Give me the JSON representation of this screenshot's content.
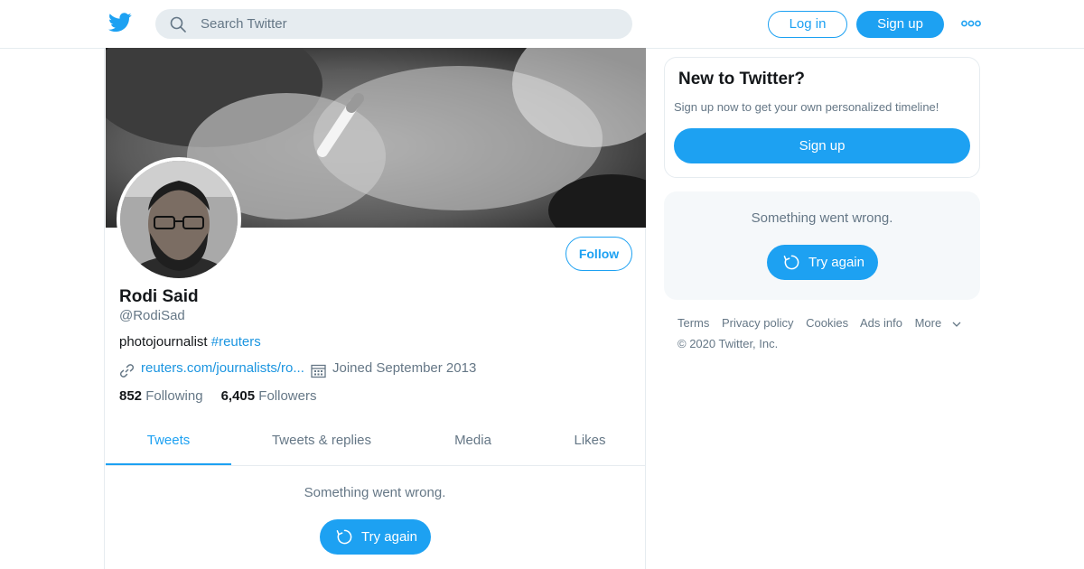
{
  "header": {
    "search_placeholder": "Search Twitter",
    "login_label": "Log in",
    "signup_label": "Sign up"
  },
  "profile": {
    "name": "Rodi Said",
    "handle": "@RodiSad",
    "bio_text": "photojournalist ",
    "bio_hashtag": "#reuters",
    "website": "reuters.com/journalists/ro...",
    "joined": "Joined September 2013",
    "following_count": "852",
    "following_label": "Following",
    "followers_count": "6,405",
    "followers_label": "Followers",
    "follow_label": "Follow"
  },
  "tabs": [
    {
      "label": "Tweets",
      "active": true
    },
    {
      "label": "Tweets & replies",
      "active": false
    },
    {
      "label": "Media",
      "active": false
    },
    {
      "label": "Likes",
      "active": false
    }
  ],
  "timeline": {
    "error_text": "Something went wrong.",
    "retry_label": "Try again"
  },
  "sidebar": {
    "new_title": "New to Twitter?",
    "new_subtitle": "Sign up now to get your own personalized timeline!",
    "signup_label": "Sign up",
    "error_text": "Something went wrong.",
    "retry_label": "Try again",
    "footer_links": [
      "Terms",
      "Privacy policy",
      "Cookies",
      "Ads info",
      "More"
    ],
    "copyright": "© 2020 Twitter, Inc."
  },
  "colors": {
    "accent": "#1da1f2",
    "link": "#1b95e0",
    "muted": "#657786",
    "border": "#e6ecf0"
  },
  "icons": [
    "twitter-bird-icon",
    "search-icon",
    "more-dots-icon",
    "link-icon",
    "calendar-icon",
    "refresh-icon",
    "chevron-down-icon"
  ]
}
